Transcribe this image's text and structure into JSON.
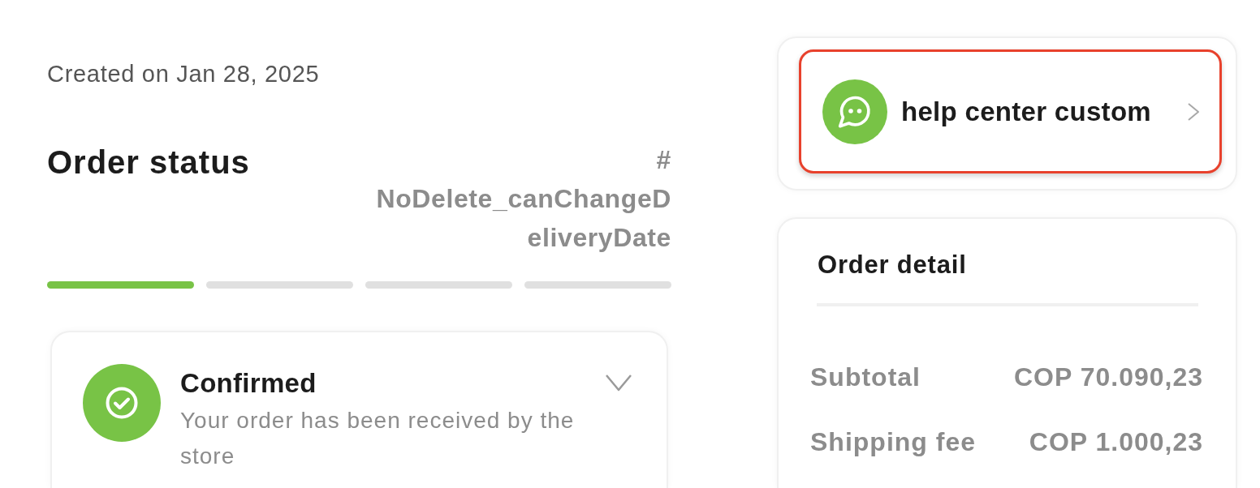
{
  "created": "Created on Jan 28, 2025",
  "order_status": {
    "title": "Order status",
    "order_number": "# NoDelete_canChangeDeliveryDate",
    "steps": [
      {
        "done": true
      },
      {
        "done": false
      },
      {
        "done": false
      },
      {
        "done": false
      }
    ]
  },
  "status_card": {
    "title": "Confirmed",
    "description": "Your order has been received by the store",
    "expanded": false
  },
  "help_center": {
    "label": "help center custom",
    "highlighted": true
  },
  "order_detail": {
    "title": "Order detail",
    "rows": [
      {
        "label": "Subtotal",
        "value": "COP 70.090,23"
      },
      {
        "label": "Shipping fee",
        "value": "COP 1.000,23"
      }
    ]
  }
}
